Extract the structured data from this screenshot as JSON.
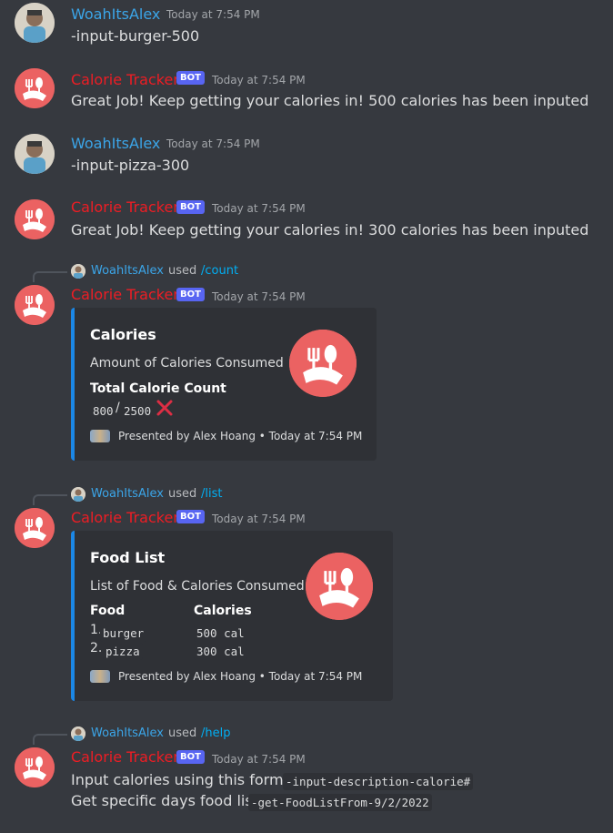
{
  "users": {
    "human": "WoahItsAlex",
    "bot": "Calorie Tracker",
    "bot_badge": "BOT"
  },
  "colors": {
    "user_name": "#3ba5e8",
    "bot_name": "#ed1d24",
    "embed_accent": "#1b87e6",
    "badge": "#5865f2",
    "bot_avatar": "#eb6262"
  },
  "timestamp": "Today at 7:54 PM",
  "messages": {
    "m1": {
      "text": "-input-burger-500"
    },
    "m2": {
      "text": "Great Job! Keep getting your calories in! 500 calories has been inputed"
    },
    "m3": {
      "text": "-input-pizza-300"
    },
    "m4": {
      "text": "Great Job! Keep getting your calories in! 300 calories has been inputed"
    },
    "m5": {
      "reply_used": "used",
      "reply_cmd": "/count",
      "embed": {
        "title": "Calories",
        "description": "Amount of Calories Consumed",
        "field_name": "Total Calorie Count",
        "count": "800",
        "separator": "/",
        "goal": "2500",
        "status_icon": "cross-mark-icon",
        "footer": "Presented by Alex Hoang • Today at 7:54 PM"
      }
    },
    "m6": {
      "reply_used": "used",
      "reply_cmd": "/list",
      "embed": {
        "title": "Food List",
        "description": "List of Food & Calories Consumed",
        "food_header": "Food",
        "cal_header": "Calories",
        "items": [
          {
            "num": "1.",
            "food": "burger",
            "cal": "500 cal"
          },
          {
            "num": "2.",
            "food": "pizza",
            "cal": "300 cal"
          }
        ],
        "footer": "Presented by Alex Hoang • Today at 7:54 PM"
      }
    },
    "m7": {
      "reply_used": "used",
      "reply_cmd": "/help",
      "line1_text": "Input calories using this format:",
      "line1_code": "-input-description-calorie#",
      "line2_text": "Get specific days food list:",
      "line2_code": "-get-FoodListFrom-9/2/2022"
    }
  }
}
